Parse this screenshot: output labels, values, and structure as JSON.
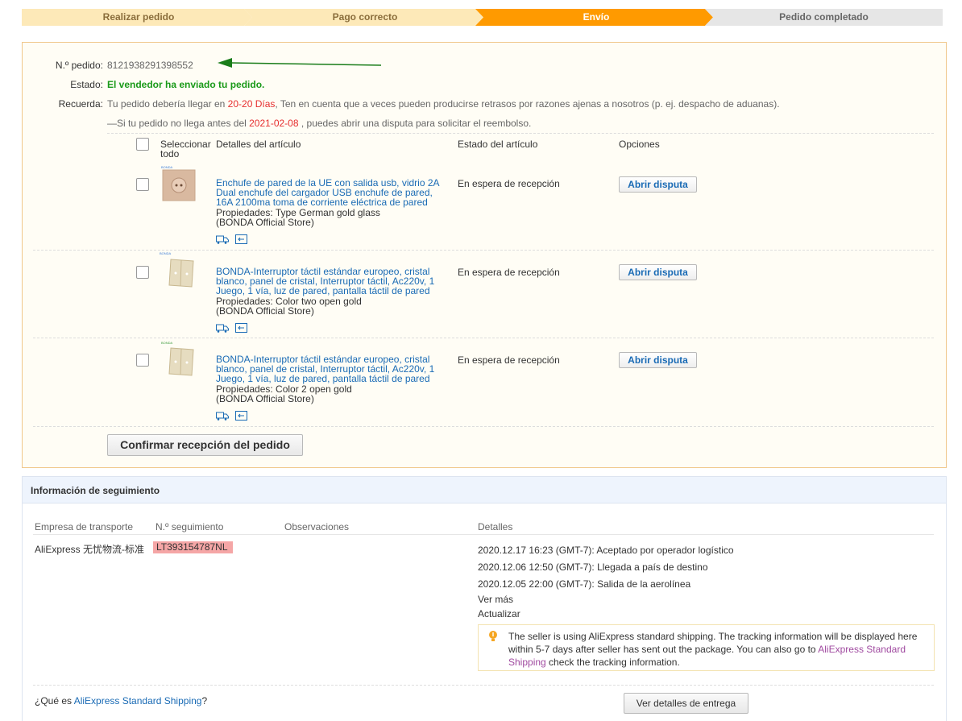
{
  "steps": [
    "Realizar pedido",
    "Pago correcto",
    "Envío",
    "Pedido completado"
  ],
  "order": {
    "number_label": "N.º pedido:",
    "number": "8121938291398552",
    "status_label": "Estado:",
    "status": "El vendedor ha enviado tu pedido.",
    "remember_label": "Recuerda:",
    "remember_pre": "Tu pedido debería llegar en ",
    "remember_days": "20-20 Días",
    "remember_post": ", Ten en cuenta que a veces pueden producirse retrasos por razones ajenas a nosotros (p. ej. despacho de aduanas).",
    "dispute_pre": "—Si tu pedido no llega antes del ",
    "dispute_date": "2021-02-08",
    "dispute_post": " , puedes abrir una disputa para solicitar el reembolso."
  },
  "table": {
    "select_all": "Seleccionar todo",
    "col_details": "Detalles del artículo",
    "col_status": "Estado del artículo",
    "col_options": "Opciones"
  },
  "items": [
    {
      "title": "Enchufe de pared de la UE con salida usb, vidrio 2A Dual enchufe del cargador USB enchufe de pared, 16A 2100ma toma de corriente eléctrica de pared",
      "props": "Propiedades: Type German gold glass",
      "store": "(BONDA Official Store)",
      "status": "En espera de recepción",
      "action": "Abrir disputa"
    },
    {
      "title": "BONDA-Interruptor táctil estándar europeo, cristal blanco, panel de cristal, Interruptor táctil, Ac220v, 1 Juego, 1 vía, luz de pared, pantalla táctil de pared",
      "props": "Propiedades: Color two open gold",
      "store": "(BONDA Official Store)",
      "status": "En espera de recepción",
      "action": "Abrir disputa"
    },
    {
      "title": "BONDA-Interruptor táctil estándar europeo, cristal blanco, panel de cristal, Interruptor táctil, Ac220v, 1 Juego, 1 vía, luz de pared, pantalla táctil de pared",
      "props": "Propiedades: Color 2 open gold",
      "store": "(BONDA Official Store)",
      "status": "En espera de recepción",
      "action": "Abrir disputa"
    }
  ],
  "confirm_button": "Confirmar recepción del pedido",
  "tracking": {
    "title": "Información de seguimiento",
    "col_carrier": "Empresa de transporte",
    "col_number": "N.º seguimiento",
    "col_notes": "Observaciones",
    "col_details": "Detalles",
    "carrier": "AliExpress 无忧物流-标准",
    "number": "LT393154787NL",
    "events": [
      "2020.12.17 16:23 (GMT-7): Aceptado por operador logístico",
      "2020.12.06 12:50 (GMT-7): Llegada a país de destino",
      "2020.12.05 22:00 (GMT-7): Salida de la aerolínea"
    ],
    "more": "Ver más",
    "refresh": "Actualizar",
    "notice_pre": "The seller is using AliExpress standard shipping. The tracking information will be displayed here within 5-7 days after seller has sent out the package. You can also go to ",
    "notice_link": "AliExpress Standard Shipping",
    "notice_post": " check the tracking information.",
    "question_pre": "¿Qué es ",
    "question_link": "AliExpress Standard Shipping",
    "question_post": "?",
    "delivery_button": "Ver detalles de entrega"
  },
  "colors": {
    "step_done": "#fde9b8",
    "step_active": "#ff9a00",
    "step_todo": "#e6e6e6",
    "arrow": "#1a7d1a"
  }
}
